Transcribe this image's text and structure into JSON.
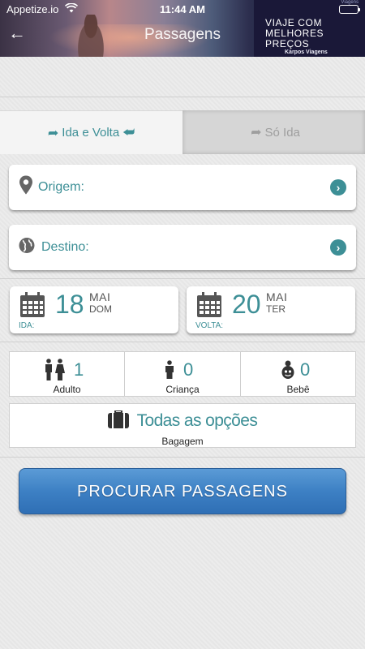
{
  "status_bar": {
    "carrier": "Appetize.io",
    "time": "11:44 AM"
  },
  "header": {
    "title": "Passagens"
  },
  "ad": {
    "title": "VIAJE COM MELHORES PREÇOS",
    "brand": "Karpos Viagens",
    "mark": "Viagens"
  },
  "trip_tabs": {
    "round_trip": "Ida e Volta",
    "one_way": "Só Ida"
  },
  "origin": {
    "label": "Origem:"
  },
  "destination": {
    "label": "Destino:"
  },
  "departure": {
    "day": "18",
    "month": "MAI",
    "weekday": "DOM",
    "caption": "IDA:"
  },
  "return": {
    "day": "20",
    "month": "MAI",
    "weekday": "TER",
    "caption": "VOLTA:"
  },
  "passengers": [
    {
      "count": "1",
      "label": "Adulto",
      "icon": "adult-couple-icon"
    },
    {
      "count": "0",
      "label": "Criança",
      "icon": "child-icon"
    },
    {
      "count": "0",
      "label": "Bebê",
      "icon": "baby-icon"
    }
  ],
  "baggage": {
    "value": "Todas as opções",
    "label": "Bagagem",
    "icon": "suitcase-icon"
  },
  "search_button": {
    "label": "PROCURAR PASSAGENS"
  },
  "colors": {
    "accent": "#3d8f96",
    "button": "#3d80c4",
    "ad_bg": "#1a1838"
  }
}
